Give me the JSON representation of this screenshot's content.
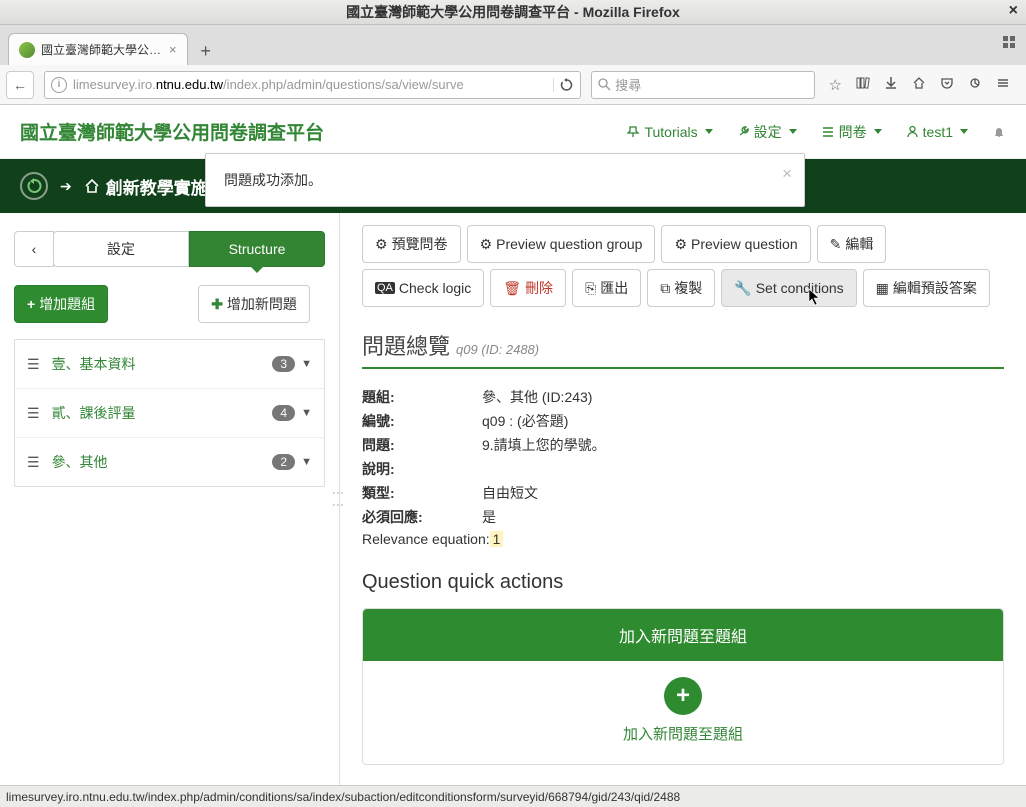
{
  "window": {
    "title": "國立臺灣師範大學公用問卷調查平台 - Mozilla Firefox"
  },
  "tab": {
    "title": "國立臺灣師範大學公…"
  },
  "url": {
    "value": "limesurvey.iro.ntnu.edu.tw/index.php/admin/questions/sa/view/surve"
  },
  "search": {
    "placeholder": "搜尋"
  },
  "brand": "國立臺灣師範大學公用問卷調查平台",
  "menu": {
    "tutorials": "Tutorials",
    "settings": "設定",
    "questions": "問卷",
    "user": "test1"
  },
  "breadcrumb": {
    "survey": "創新教學實施"
  },
  "alert": {
    "text": "問題成功添加。"
  },
  "sidebar": {
    "back": "‹",
    "tabs": {
      "settings": "設定",
      "structure": "Structure"
    },
    "add_group": "增加題組",
    "add_question": "增加新問題",
    "groups": [
      {
        "name": "壹、基本資料",
        "count": "3"
      },
      {
        "name": "貳、課後評量",
        "count": "4"
      },
      {
        "name": "參、其他",
        "count": "2"
      }
    ]
  },
  "toolbar": {
    "preview_survey": "預覽問卷",
    "preview_group": "Preview question group",
    "preview_question": "Preview question",
    "edit": "編輯",
    "check_logic": "Check logic",
    "delete": "刪除",
    "export": "匯出",
    "copy": "複製",
    "set_conditions": "Set conditions",
    "edit_defaults": "編輯預設答案"
  },
  "overview": {
    "title": "問題總覽",
    "sub": "q09 (ID: 2488)",
    "rows": {
      "group_k": "題組:",
      "group_v": "參、其他 (ID:243)",
      "code_k": "編號:",
      "code_v": "q09 : (必答題)",
      "question_k": "問題:",
      "question_v": "9.請填上您的學號。",
      "help_k": "說明:",
      "type_k": "類型:",
      "type_v": "自由短文",
      "mandatory_k": "必須回應:",
      "mandatory_v": "是",
      "relevance_k": "Relevance equation:",
      "relevance_v": "1"
    }
  },
  "quick": {
    "heading": "Question quick actions",
    "panel_title": "加入新問題至題組",
    "panel_link": "加入新問題至題組"
  },
  "statusbar": "limesurvey.iro.ntnu.edu.tw/index.php/admin/conditions/sa/index/subaction/editconditionsform/surveyid/668794/gid/243/qid/2488"
}
